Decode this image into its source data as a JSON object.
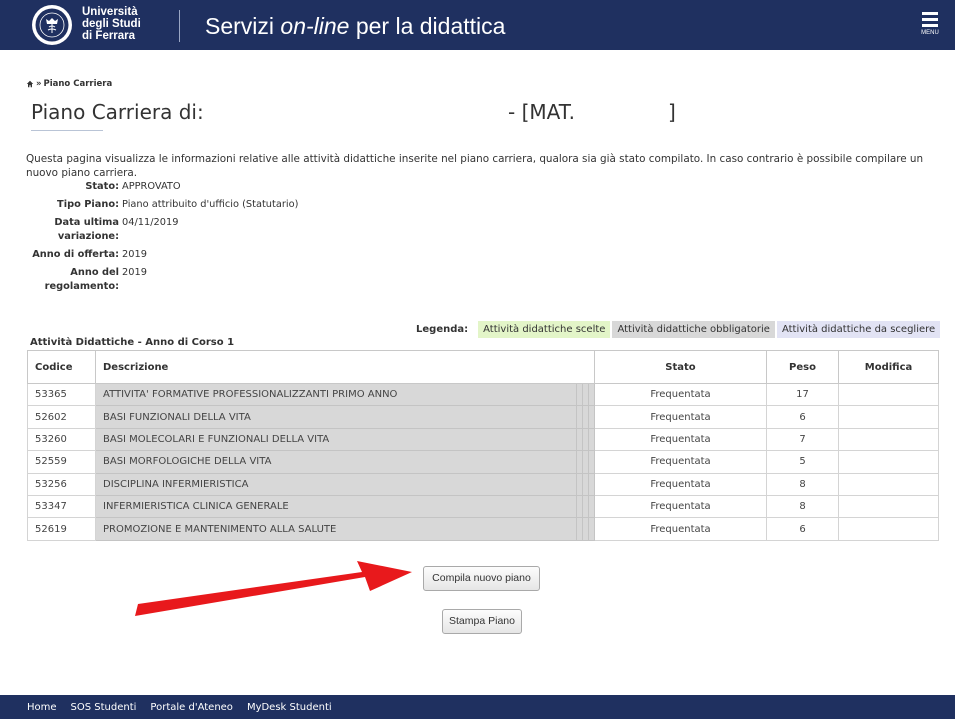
{
  "header": {
    "logo_lines": [
      "Università",
      "degli Studi",
      "di Ferrara"
    ],
    "site_title_before": "Servizi ",
    "site_title_em": "on-line",
    "site_title_after": " per la didattica",
    "menu_label": "MENU"
  },
  "breadcrumb": {
    "separator": "»",
    "current": "Piano Carriera"
  },
  "page": {
    "title": "Piano Carriera di:",
    "title_mat": "- [MAT.",
    "title_end": "]",
    "intro": "Questa pagina visualizza le informazioni relative alle attività didattiche inserite nel piano carriera, qualora sia già stato compilato. In caso contrario è possibile compilare un nuovo piano carriera."
  },
  "info": [
    {
      "label": "Stato:",
      "value": "APPROVATO"
    },
    {
      "label": "Tipo Piano:",
      "value": "Piano attribuito d'ufficio (Statutario)"
    },
    {
      "label": "Data ultima variazione:",
      "value": "04/11/2019"
    },
    {
      "label": "Anno di offerta:",
      "value": "2019"
    },
    {
      "label": "Anno del regolamento:",
      "value": "2019"
    }
  ],
  "legend": {
    "label": "Legenda:",
    "items": [
      {
        "text": "Attività didattiche scelte",
        "color": "#e3f5c8"
      },
      {
        "text": "Attività didattiche obbligatorie",
        "color": "#d8d8d8"
      },
      {
        "text": "Attività didattiche da scegliere",
        "color": "#e2e3f4"
      }
    ]
  },
  "table": {
    "caption": "Attività Didattiche - Anno di Corso 1",
    "headers": {
      "codice": "Codice",
      "descrizione": "Descrizione",
      "stato": "Stato",
      "peso": "Peso",
      "modifica": "Modifica"
    },
    "rows": [
      {
        "codice": "53365",
        "descrizione": "ATTIVITA' FORMATIVE PROFESSIONALIZZANTI PRIMO ANNO",
        "stato": "Frequentata",
        "peso": "17"
      },
      {
        "codice": "52602",
        "descrizione": "BASI FUNZIONALI DELLA VITA",
        "stato": "Frequentata",
        "peso": "6"
      },
      {
        "codice": "53260",
        "descrizione": "BASI MOLECOLARI E FUNZIONALI DELLA VITA",
        "stato": "Frequentata",
        "peso": "7"
      },
      {
        "codice": "52559",
        "descrizione": "BASI MORFOLOGICHE DELLA VITA",
        "stato": "Frequentata",
        "peso": "5"
      },
      {
        "codice": "53256",
        "descrizione": "DISCIPLINA INFERMIERISTICA",
        "stato": "Frequentata",
        "peso": "8"
      },
      {
        "codice": "53347",
        "descrizione": "INFERMIERISTICA CLINICA GENERALE",
        "stato": "Frequentata",
        "peso": "8"
      },
      {
        "codice": "52619",
        "descrizione": "PROMOZIONE E MANTENIMENTO ALLA SALUTE",
        "stato": "Frequentata",
        "peso": "6"
      }
    ]
  },
  "buttons": {
    "compila": "Compila nuovo piano",
    "stampa": "Stampa  Piano"
  },
  "colors": {
    "header_bg": "#1f3060",
    "footer_bg": "#1f3060",
    "arrow": "#e8191c"
  },
  "footer": {
    "links": [
      "Home",
      "SOS Studenti",
      "Portale d'Ateneo",
      "MyDesk Studenti"
    ]
  }
}
